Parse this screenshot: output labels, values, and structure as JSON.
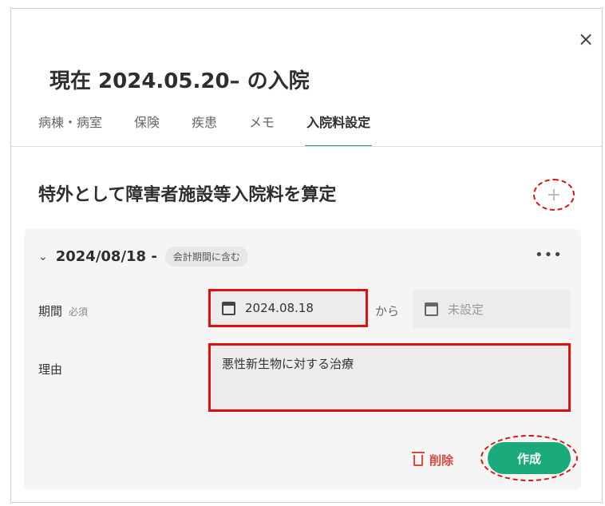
{
  "dialog": {
    "close_icon": "×",
    "title": "現在 2024.05.20– の入院"
  },
  "tabs": [
    {
      "label": "病棟・病室",
      "active": false
    },
    {
      "label": "保険",
      "active": false
    },
    {
      "label": "疾患",
      "active": false
    },
    {
      "label": "メモ",
      "active": false
    },
    {
      "label": "入院料設定",
      "active": true
    }
  ],
  "section": {
    "title": "特外として障害者施設等入院料を算定",
    "add_icon": "+"
  },
  "card": {
    "chevron": "⌄",
    "date": "2024/08/18 -",
    "badge": "会計期間に含む",
    "more_icon": "•••",
    "period_label": "期間",
    "required_label": "必須",
    "start_date": "2024.08.18",
    "from_label": "から",
    "end_placeholder": "未設定",
    "reason_label": "理由",
    "reason_value": "悪性新生物に対する治療",
    "delete_label": "削除",
    "create_label": "作成"
  },
  "colors": {
    "accent": "#1aaa7c",
    "danger": "#e0473e",
    "highlight": "#e01010"
  }
}
